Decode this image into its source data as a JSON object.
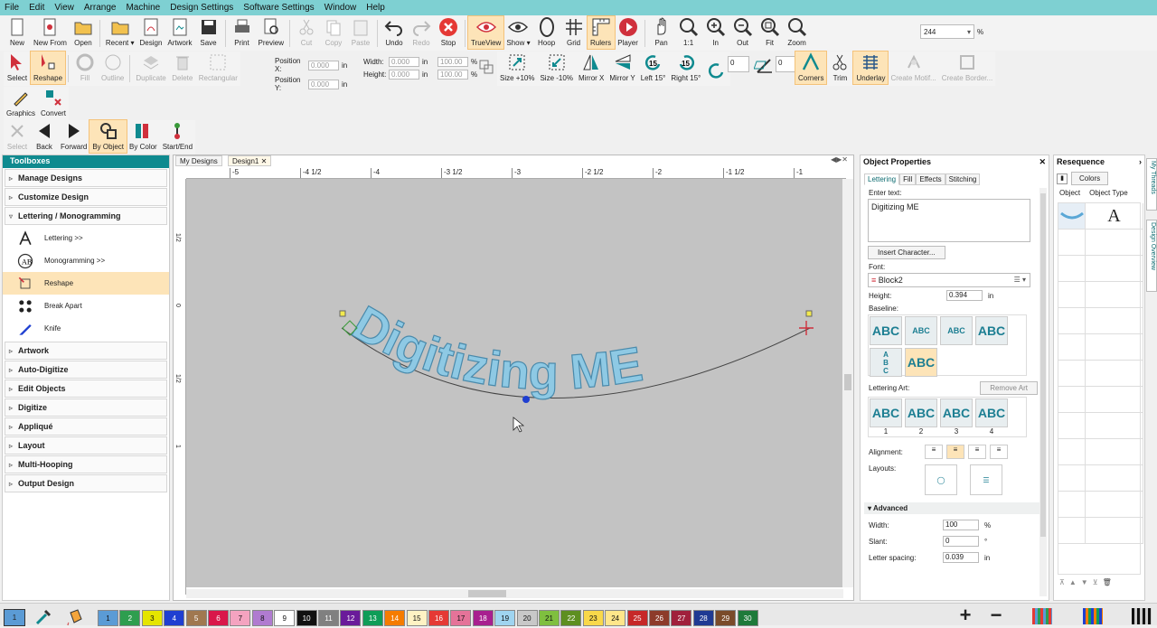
{
  "menu": [
    "File",
    "Edit",
    "View",
    "Arrange",
    "Machine",
    "Design Settings",
    "Software Settings",
    "Window",
    "Help"
  ],
  "toolbar1": [
    {
      "label": "New",
      "icon": "new-icon"
    },
    {
      "label": "New From",
      "icon": "new-from-icon"
    },
    {
      "label": "Open",
      "icon": "open-folder-icon"
    },
    {
      "label": "Recent ▾",
      "icon": "recent-icon"
    },
    {
      "label": "Design",
      "icon": "design-icon"
    },
    {
      "label": "Artwork",
      "icon": "artwork-icon"
    },
    {
      "label": "Save",
      "icon": "save-icon"
    },
    {
      "label": "Print",
      "icon": "print-icon"
    },
    {
      "label": "Preview",
      "icon": "preview-icon"
    },
    {
      "label": "Cut",
      "icon": "cut-icon",
      "disabled": true
    },
    {
      "label": "Copy",
      "icon": "copy-icon",
      "disabled": true
    },
    {
      "label": "Paste",
      "icon": "paste-icon",
      "disabled": true
    },
    {
      "label": "Undo",
      "icon": "undo-icon"
    },
    {
      "label": "Redo",
      "icon": "redo-icon",
      "disabled": true
    },
    {
      "label": "Stop",
      "icon": "stop-icon"
    },
    {
      "label": "TrueView",
      "icon": "trueview-icon",
      "selected": true
    },
    {
      "label": "Show ▾",
      "icon": "show-eye-icon"
    },
    {
      "label": "Hoop",
      "icon": "hoop-icon"
    },
    {
      "label": "Grid",
      "icon": "grid-icon"
    },
    {
      "label": "Rulers",
      "icon": "rulers-icon",
      "selected": true
    },
    {
      "label": "Player",
      "icon": "player-icon"
    },
    {
      "label": "Pan",
      "icon": "pan-hand-icon"
    },
    {
      "label": "1:1",
      "icon": "zoom-1-1-icon"
    },
    {
      "label": "In",
      "icon": "zoom-in-icon"
    },
    {
      "label": "Out",
      "icon": "zoom-out-icon"
    },
    {
      "label": "Fit",
      "icon": "zoom-fit-icon"
    },
    {
      "label": "Zoom",
      "icon": "zoom-icon"
    }
  ],
  "zoom": {
    "value": "244",
    "unit": "%"
  },
  "toolbar2": {
    "tools": [
      {
        "label": "Select",
        "icon": "select-arrow-icon"
      },
      {
        "label": "Reshape",
        "icon": "reshape-icon",
        "selected": true
      },
      {
        "label": "Fill",
        "icon": "fill-icon",
        "disabled": true
      },
      {
        "label": "Outline",
        "icon": "outline-icon",
        "disabled": true
      },
      {
        "label": "Duplicate",
        "icon": "duplicate-icon",
        "disabled": true
      },
      {
        "label": "Delete",
        "icon": "delete-icon",
        "disabled": true
      },
      {
        "label": "Rectangular",
        "icon": "rectangular-icon",
        "disabled": true
      }
    ],
    "position_x_label": "Position X:",
    "position_y_label": "Position Y:",
    "width_label": "Width:",
    "height_label": "Height:",
    "pos_x": "0.000",
    "pos_y": "0.000",
    "width": "0.000",
    "height": "0.000",
    "unit": "in",
    "pct_w": "100.00",
    "pct_h": "100.00",
    "pct": "%",
    "tools2": [
      {
        "label": "Size +10%",
        "icon": "size-plus-icon"
      },
      {
        "label": "Size -10%",
        "icon": "size-minus-icon"
      },
      {
        "label": "Mirror X",
        "icon": "mirror-x-icon"
      },
      {
        "label": "Mirror Y",
        "icon": "mirror-y-icon"
      },
      {
        "label": "Left 15°",
        "icon": "rotate-left-icon"
      },
      {
        "label": "Right 15°",
        "icon": "rotate-right-icon"
      }
    ],
    "rotate_value": "0",
    "slant_value": "0",
    "tools3": [
      {
        "label": "Corners",
        "icon": "corners-icon",
        "selected": true
      },
      {
        "label": "Trim",
        "icon": "trim-icon"
      },
      {
        "label": "Underlay",
        "icon": "underlay-icon",
        "selected": true
      },
      {
        "label": "Create Motif...",
        "icon": "create-motif-icon",
        "disabled": true
      },
      {
        "label": "Create Border...",
        "icon": "create-border-icon",
        "disabled": true
      }
    ]
  },
  "toolbar3": [
    {
      "label": "Graphics",
      "icon": "graphics-pen-icon"
    },
    {
      "label": "Convert",
      "icon": "convert-icon"
    }
  ],
  "toolbar4": [
    {
      "label": "Select",
      "icon": "sequence-select-icon",
      "disabled": true
    },
    {
      "label": "Back",
      "icon": "back-triangle-icon"
    },
    {
      "label": "Forward",
      "icon": "forward-triangle-icon"
    },
    {
      "label": "By Object",
      "icon": "by-object-icon",
      "selected": true
    },
    {
      "label": "By Color",
      "icon": "by-color-icon"
    },
    {
      "label": "Start/End",
      "icon": "start-end-icon"
    }
  ],
  "toolboxes": {
    "title": "Toolboxes",
    "sections_top": [
      "Manage Designs",
      "Customize Design"
    ],
    "open_section": "Lettering / Monogramming",
    "tools": [
      {
        "label": "Lettering >>",
        "icon": "lettering-a-icon"
      },
      {
        "label": "Monogramming >>",
        "icon": "monogram-icon"
      },
      {
        "label": "Reshape",
        "icon": "reshape-tool-icon",
        "selected": true
      },
      {
        "label": "Break Apart",
        "icon": "break-apart-icon"
      },
      {
        "label": "Knife",
        "icon": "knife-icon"
      }
    ],
    "sections_bottom": [
      "Artwork",
      "Auto-Digitize",
      "Edit Objects",
      "Digitize",
      "Appliqué",
      "Layout",
      "Multi-Hooping",
      "Output Design"
    ]
  },
  "tabs": [
    "My Designs",
    "Design1"
  ],
  "ruler_top": [
    "-5",
    "-4 1/2",
    "-4",
    "-3 1/2",
    "-3",
    "-2 1/2",
    "-2",
    "-1 1/2",
    "-1"
  ],
  "ruler_left": [
    "1/2",
    "0",
    "1/2",
    "1"
  ],
  "design_text": "Digitizing ME",
  "thread_color": "#8ec9e4",
  "properties": {
    "title": "Object Properties",
    "tabs": [
      "Lettering",
      "Fill",
      "Effects",
      "Stitching"
    ],
    "enter_text_label": "Enter text:",
    "text_value": "Digitizing ME",
    "insert_char_label": "Insert Character...",
    "font_label": "Font:",
    "font_value": "Block2",
    "height_label": "Height:",
    "height_value": "0.394",
    "height_unit": "in",
    "baseline_label": "Baseline:",
    "lettering_art_label": "Lettering Art:",
    "remove_art_label": "Remove Art",
    "art_numbers": [
      "1",
      "2",
      "3",
      "4"
    ],
    "alignment_label": "Alignment:",
    "layouts_label": "Layouts:",
    "advanced_label": "Advanced",
    "width_label": "Width:",
    "width_value": "100",
    "width_unit": "%",
    "slant_label": "Slant:",
    "slant_value": "0",
    "slant_unit": "°",
    "spacing_label": "Letter spacing:",
    "spacing_value": "0.039",
    "spacing_unit": "in"
  },
  "resequence": {
    "title": "Resequence",
    "colors_label": "Colors",
    "col_object": "Object",
    "col_type": "Object Type"
  },
  "side_tabs": [
    "My Threads",
    "Design Overview"
  ],
  "palette": [
    {
      "n": "1",
      "c": "#5b9bd5"
    },
    {
      "n": "2",
      "c": "#2e9e4f"
    },
    {
      "n": "3",
      "c": "#e5e500"
    },
    {
      "n": "4",
      "c": "#1f3fd1"
    },
    {
      "n": "5",
      "c": "#a07850"
    },
    {
      "n": "6",
      "c": "#d9174a"
    },
    {
      "n": "7",
      "c": "#f4a3c0"
    },
    {
      "n": "8",
      "c": "#b07bd0"
    },
    {
      "n": "9",
      "c": "#ffffff"
    },
    {
      "n": "10",
      "c": "#111111"
    },
    {
      "n": "11",
      "c": "#808080"
    },
    {
      "n": "12",
      "c": "#6a1b9a"
    },
    {
      "n": "13",
      "c": "#0f9d58"
    },
    {
      "n": "14",
      "c": "#f57c00"
    },
    {
      "n": "15",
      "c": "#fff3c4"
    },
    {
      "n": "16",
      "c": "#e53935"
    },
    {
      "n": "17",
      "c": "#e57399"
    },
    {
      "n": "18",
      "c": "#a8208f"
    },
    {
      "n": "19",
      "c": "#9fd4f0"
    },
    {
      "n": "20",
      "c": "#c8c8c8"
    },
    {
      "n": "21",
      "c": "#7fbf3f"
    },
    {
      "n": "22",
      "c": "#5e8f20"
    },
    {
      "n": "23",
      "c": "#f9d84a"
    },
    {
      "n": "24",
      "c": "#ffe68a"
    },
    {
      "n": "25",
      "c": "#c62828"
    },
    {
      "n": "26",
      "c": "#8d3b2a"
    },
    {
      "n": "27",
      "c": "#a0203c"
    },
    {
      "n": "28",
      "c": "#1f3a93"
    },
    {
      "n": "29",
      "c": "#7a4b2a"
    },
    {
      "n": "30",
      "c": "#1e7a3a"
    }
  ]
}
